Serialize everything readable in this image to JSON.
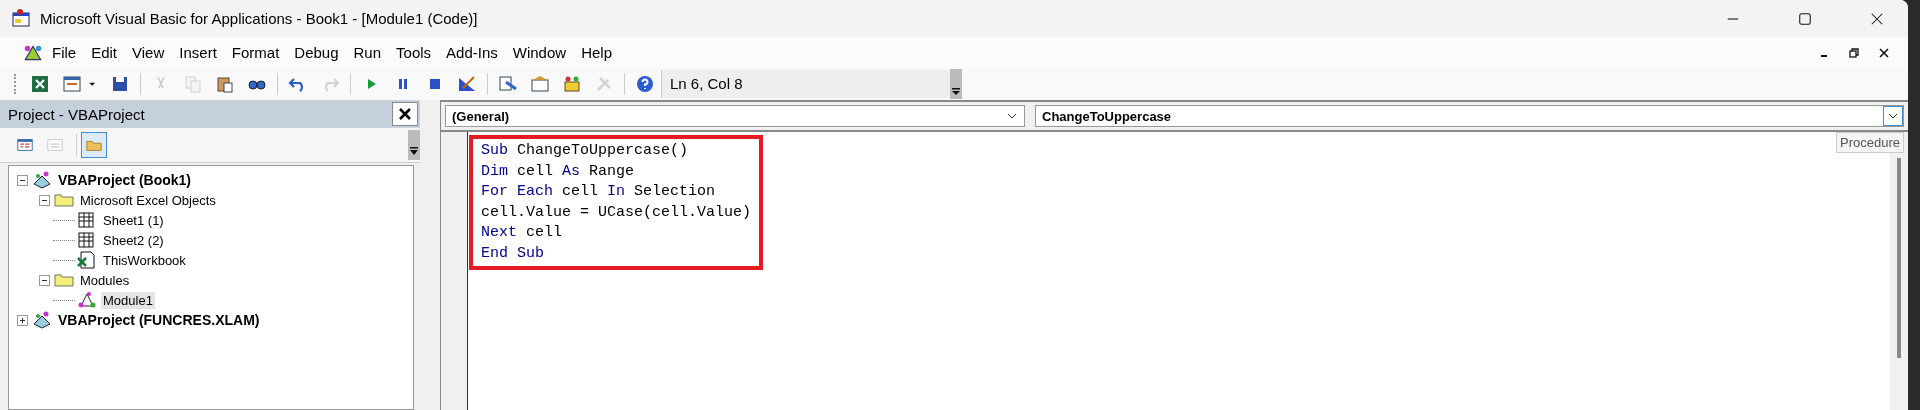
{
  "window": {
    "title": "Microsoft Visual Basic for Applications - Book1 - [Module1 (Code)]"
  },
  "menu": [
    "File",
    "Edit",
    "View",
    "Insert",
    "Format",
    "Debug",
    "Run",
    "Tools",
    "Add-Ins",
    "Window",
    "Help"
  ],
  "toolbar": {
    "groups": [
      [
        {
          "kind": "excel",
          "disabled": false
        },
        {
          "kind": "userform",
          "disabled": false
        },
        {
          "kind": "caret",
          "disabled": false
        },
        {
          "kind": "save",
          "disabled": false
        }
      ],
      [
        {
          "kind": "cut",
          "disabled": true
        },
        {
          "kind": "copy",
          "disabled": true
        },
        {
          "kind": "paste",
          "disabled": false
        },
        {
          "kind": "find",
          "disabled": false
        }
      ],
      [
        {
          "kind": "undo",
          "disabled": false
        },
        {
          "kind": "redo",
          "disabled": true
        }
      ],
      [
        {
          "kind": "run",
          "disabled": false
        },
        {
          "kind": "pause",
          "disabled": false
        },
        {
          "kind": "stop",
          "disabled": false
        },
        {
          "kind": "design",
          "disabled": false
        }
      ],
      [
        {
          "kind": "explorer",
          "disabled": false
        },
        {
          "kind": "properties",
          "disabled": false
        },
        {
          "kind": "browser",
          "disabled": false
        },
        {
          "kind": "toolbox",
          "disabled": true
        }
      ],
      [
        {
          "kind": "help",
          "disabled": false
        }
      ]
    ],
    "position": "Ln 6, Col 8"
  },
  "project_pane": {
    "title": "Project - VBAProject",
    "buttons": [
      {
        "kind": "view-code",
        "disabled": false,
        "selected": false
      },
      {
        "kind": "view-object",
        "disabled": true,
        "selected": false
      },
      {
        "kind": "toggle-folders",
        "disabled": false,
        "selected": true
      }
    ],
    "tree": [
      {
        "label": "VBAProject (Book1)",
        "kind": "project",
        "expanded": true,
        "selected": false,
        "children": [
          {
            "label": "Microsoft Excel Objects",
            "kind": "folder",
            "expanded": true,
            "selected": false,
            "children": [
              {
                "label": "Sheet1 (1)",
                "kind": "sheet",
                "selected": false
              },
              {
                "label": "Sheet2 (2)",
                "kind": "sheet",
                "selected": false
              },
              {
                "label": "ThisWorkbook",
                "kind": "workbook",
                "selected": false
              }
            ]
          },
          {
            "label": "Modules",
            "kind": "folder",
            "expanded": true,
            "selected": false,
            "children": [
              {
                "label": "Module1",
                "kind": "module",
                "selected": true
              }
            ]
          }
        ]
      },
      {
        "label": "VBAProject (FUNCRES.XLAM)",
        "kind": "project",
        "expanded": false,
        "selected": false
      }
    ]
  },
  "code_window": {
    "object_combo": "(General)",
    "procedure_combo": "ChangeToUppercase",
    "tooltip": "Procedure",
    "lines": [
      [
        {
          "text": "Sub",
          "kind": "keyword"
        },
        {
          "text": " ChangeToUppercase()",
          "kind": "plain"
        }
      ],
      [
        {
          "text": "Dim",
          "kind": "keyword"
        },
        {
          "text": " cell ",
          "kind": "plain"
        },
        {
          "text": "As",
          "kind": "keyword"
        },
        {
          "text": " Range",
          "kind": "plain"
        }
      ],
      [
        {
          "text": "For Each",
          "kind": "keyword"
        },
        {
          "text": " cell ",
          "kind": "plain"
        },
        {
          "text": "In",
          "kind": "keyword"
        },
        {
          "text": " Selection",
          "kind": "plain"
        }
      ],
      [
        {
          "text": "cell.Value = UCase(cell.Value)",
          "kind": "plain"
        }
      ],
      [
        {
          "text": "Next",
          "kind": "keyword"
        },
        {
          "text": " cell",
          "kind": "plain"
        }
      ],
      [
        {
          "text": "End Sub",
          "kind": "keyword"
        }
      ]
    ],
    "highlight_box": true
  }
}
